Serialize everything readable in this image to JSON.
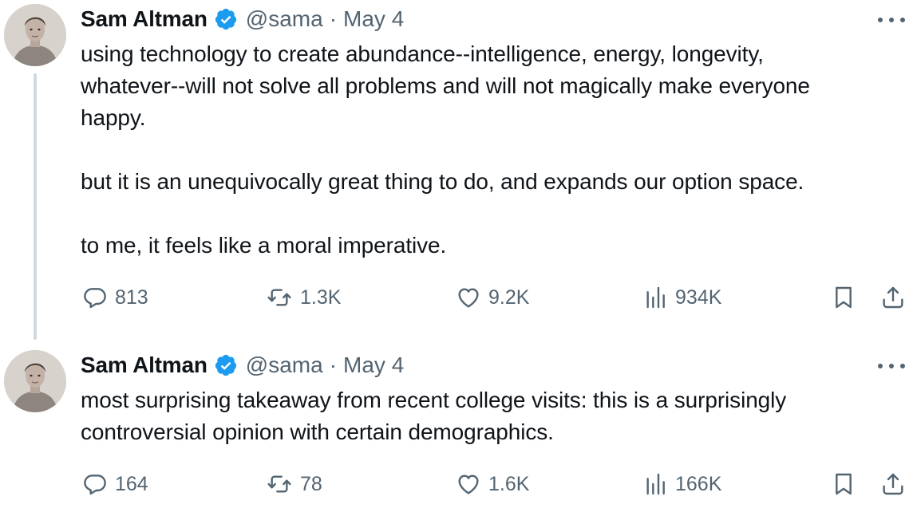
{
  "tweets": [
    {
      "author_name": "Sam Altman",
      "handle": "@sama",
      "separator": "·",
      "date": "May 4",
      "text": "using technology to create abundance--intelligence, energy, longevity,\nwhatever--will not solve all problems and will not magically make everyone\nhappy.\n\nbut it is an unequivocally great thing to do, and expands our option space.\n\nto me, it feels like a moral imperative.",
      "replies": "813",
      "reposts": "1.3K",
      "likes": "9.2K",
      "views": "934K"
    },
    {
      "author_name": "Sam Altman",
      "handle": "@sama",
      "separator": "·",
      "date": "May 4",
      "text": "most surprising takeaway from recent college visits: this is a surprisingly\ncontroversial opinion with certain demographics.",
      "replies": "164",
      "reposts": "78",
      "likes": "1.6K",
      "views": "166K"
    }
  ],
  "colors": {
    "text_primary": "#0f1419",
    "text_secondary": "#536471",
    "verified_badge": "#1d9bf0",
    "thread_line": "#cfd9de"
  },
  "icons": [
    "verified-badge-icon",
    "more-icon",
    "reply-icon",
    "repost-icon",
    "like-icon",
    "views-icon",
    "bookmark-icon",
    "share-icon"
  ]
}
